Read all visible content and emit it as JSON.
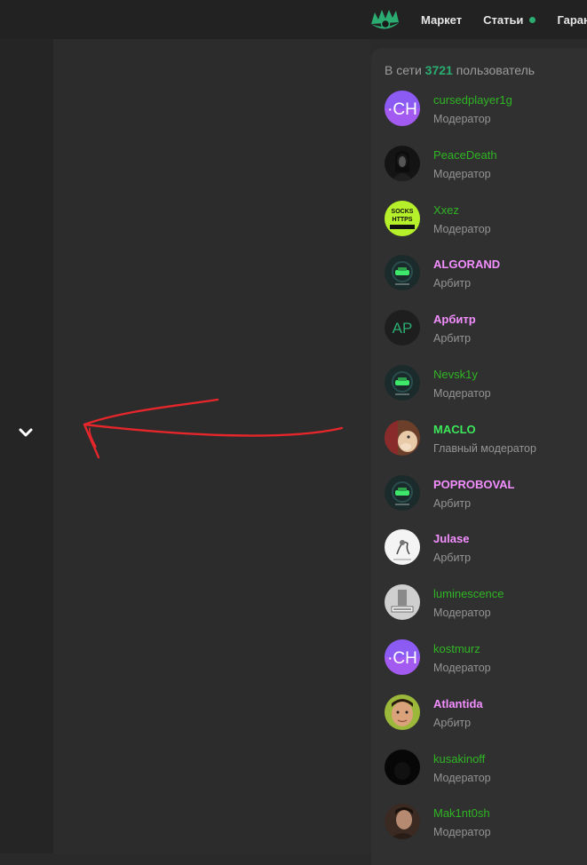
{
  "nav": {
    "items": [
      {
        "label": "Маркет",
        "dot": false
      },
      {
        "label": "Статьи",
        "dot": true
      },
      {
        "label": "Гарант",
        "dot": false
      }
    ]
  },
  "panel": {
    "prefix": "В сети",
    "count": "3721",
    "suffix": "пользователь"
  },
  "users": [
    {
      "name": "cursedplayer1g",
      "role": "Модератор",
      "style": "green",
      "avatar": "ch-logo"
    },
    {
      "name": "PeaceDeath",
      "role": "Модератор",
      "style": "green",
      "avatar": "dark-portrait"
    },
    {
      "name": "Xxez",
      "role": "Модератор",
      "style": "green",
      "avatar": "socks-logo"
    },
    {
      "name": "ALGORAND",
      "role": "Арбитр",
      "style": "pink",
      "avatar": "car-logo"
    },
    {
      "name": "Арбитр",
      "role": "Арбитр",
      "style": "pink",
      "avatar": "initials-ap",
      "initials": "AP"
    },
    {
      "name": "Nevsk1y",
      "role": "Модератор",
      "style": "green",
      "avatar": "car-logo"
    },
    {
      "name": "MACLO",
      "role": "Главный модератор",
      "style": "bright",
      "avatar": "animal-photo"
    },
    {
      "name": "POPROBOVAL",
      "role": "Арбитр",
      "style": "pink",
      "avatar": "car-logo"
    },
    {
      "name": "Julase",
      "role": "Арбитр",
      "style": "pink",
      "avatar": "sketch-white"
    },
    {
      "name": "luminescence",
      "role": "Модератор",
      "style": "green",
      "avatar": "sketch-grey"
    },
    {
      "name": "kostmurz",
      "role": "Модератор",
      "style": "green",
      "avatar": "ch-logo"
    },
    {
      "name": "Atlantida",
      "role": "Арбитр",
      "style": "pink",
      "avatar": "face-photo"
    },
    {
      "name": "kusakinoff",
      "role": "Модератор",
      "style": "green",
      "avatar": "black"
    },
    {
      "name": "Mak1nt0sh",
      "role": "Модератор",
      "style": "green",
      "avatar": "man-photo"
    }
  ],
  "colors": {
    "accent_green": "#2bad72",
    "moderator": "#2fb524",
    "head_moderator": "#3ce75a",
    "arbiter": "#f38fff",
    "annotation_arrow": "#e5262b"
  },
  "icons": {
    "chevron": "chevron-down-icon",
    "logo": "eye-logo"
  }
}
